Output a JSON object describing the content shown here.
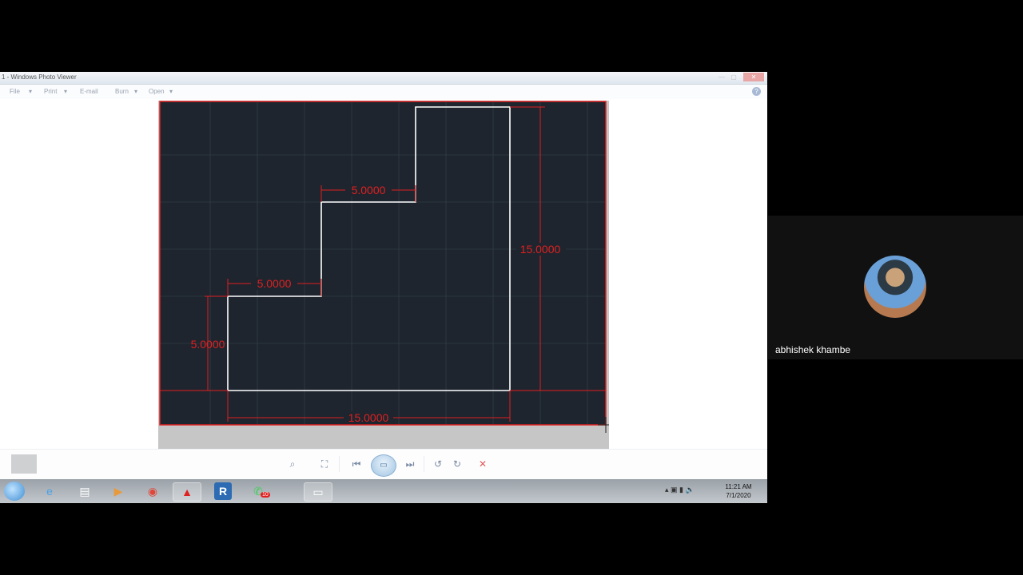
{
  "window": {
    "title": "1 - Windows Photo Viewer",
    "controls": [
      "—",
      "▢",
      "✕"
    ]
  },
  "menu": {
    "items": [
      "File",
      "Print",
      "E-mail",
      "Burn",
      "Open"
    ],
    "help": "?"
  },
  "drawing": {
    "dimensions": {
      "top_step": "5.0000",
      "middle_step": "5.0000",
      "left_height": "5.0000",
      "right_height": "15.0000",
      "bottom_width": "15.0000"
    },
    "colors": {
      "background": "#1e252e",
      "grid": "#38424d",
      "outline": "#ffffff",
      "dimension": "#e02020"
    }
  },
  "toolbar": {
    "buttons": [
      "zoom",
      "actual-size",
      "previous",
      "slideshow",
      "next",
      "rotate-left",
      "rotate-right",
      "delete"
    ]
  },
  "taskbar": {
    "apps": [
      "internet-explorer",
      "file-explorer",
      "media-player",
      "chrome",
      "autocad",
      "revit",
      "whatsapp",
      "photo-viewer"
    ],
    "whatsapp_badge": "10",
    "time": "11:21 AM",
    "date": "7/1/2020"
  },
  "participant": {
    "name": "abhishek khambe"
  }
}
